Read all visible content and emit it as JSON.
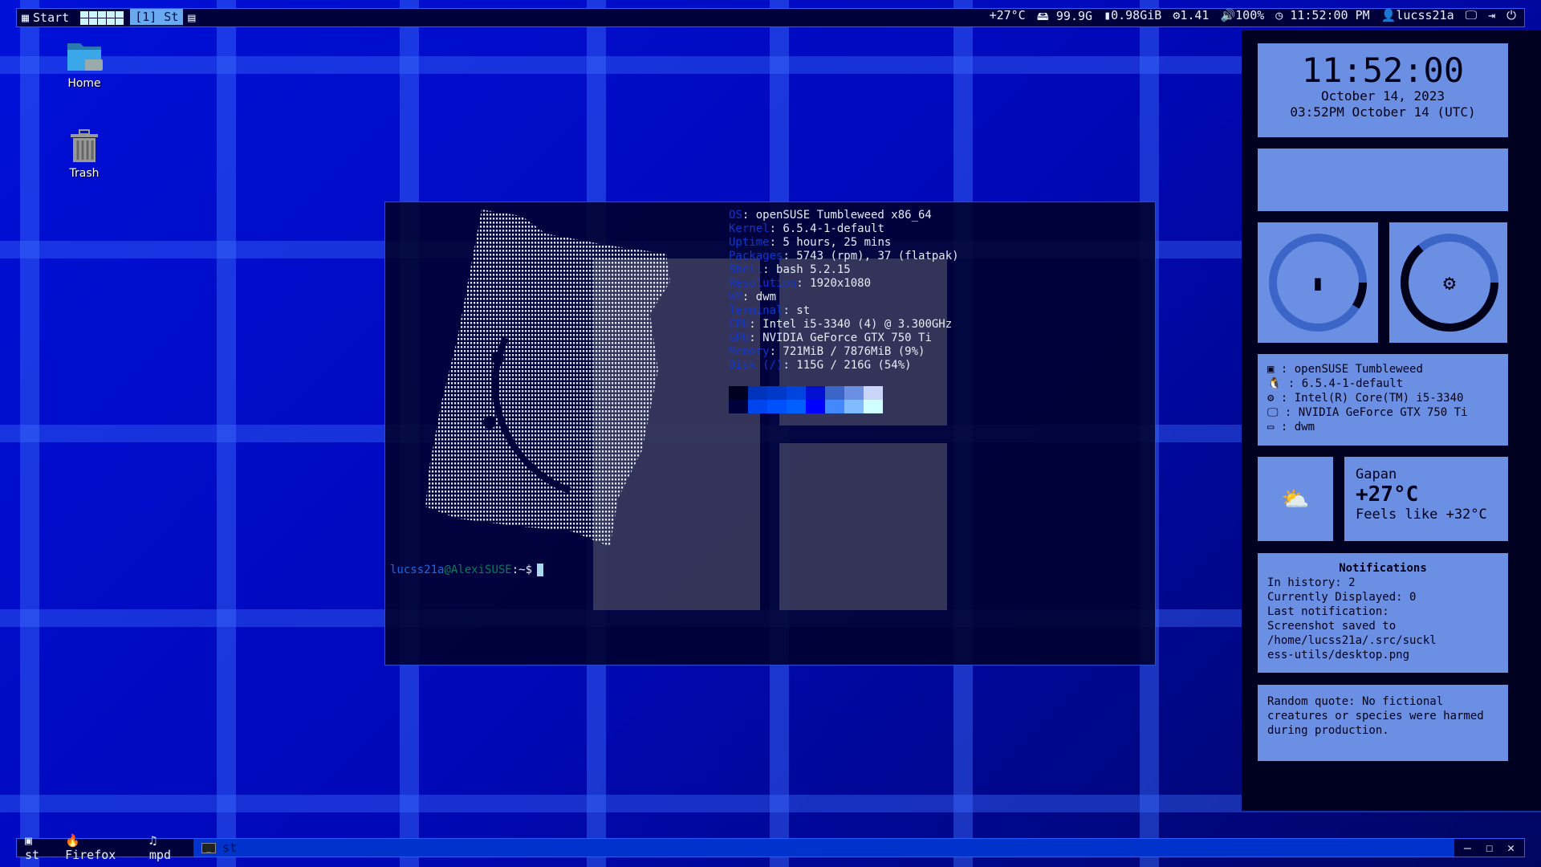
{
  "topbar": {
    "start": "Start",
    "tag": "[1] St",
    "temp": "+27°C",
    "disk": "99.9G",
    "mem": "0.98GiB",
    "cpu": "1.41",
    "volume": "100%",
    "clock": "11:52:00 PM",
    "user": "lucss21a"
  },
  "desktop": {
    "home": "Home",
    "trash": "Trash"
  },
  "terminal": {
    "info": [
      [
        "OS",
        "openSUSE Tumbleweed x86_64"
      ],
      [
        "Kernel",
        "6.5.4-1-default"
      ],
      [
        "Uptime",
        "5 hours, 25 mins"
      ],
      [
        "Packages",
        "5743 (rpm), 37 (flatpak)"
      ],
      [
        "Shell",
        "bash 5.2.15"
      ],
      [
        "Resolution",
        "1920x1080"
      ],
      [
        "WM",
        "dwm"
      ],
      [
        "Terminal",
        "st"
      ],
      [
        "CPU",
        "Intel i5-3340 (4) @ 3.300GHz"
      ],
      [
        "GPU",
        "NVIDIA GeForce GTX 750 Ti"
      ],
      [
        "Memory",
        "721MiB / 7876MiB (9%)"
      ],
      [
        "Disk (/)",
        "115G / 216G (54%)"
      ]
    ],
    "palette": [
      "#000020",
      "#0033bb",
      "#0039c8",
      "#0044e0",
      "#0010d0",
      "#3b66c8",
      "#6b8fe3",
      "#c8d4f8",
      "#00003a",
      "#0044ee",
      "#0050ff",
      "#0060ff",
      "#0000ff",
      "#4488ff",
      "#80bbff",
      "#d0ffff"
    ],
    "prompt_user": "lucss21a",
    "prompt_host": "@AlexiSUSE",
    "prompt_dir": ":~$"
  },
  "sidebar": {
    "time": "11:52:00",
    "date": "October 14, 2023",
    "utc": "03:52PM October 14 (UTC)",
    "mem_percent": 9,
    "cpu_percent": 64,
    "sysinfo": [
      {
        "icon": "distro-icon",
        "text": "openSUSE Tumbleweed"
      },
      {
        "icon": "linux-icon",
        "text": "6.5.4-1-default"
      },
      {
        "icon": "cpu-icon",
        "text": "Intel(R) Core(TM) i5-3340"
      },
      {
        "icon": "monitor-icon",
        "text": "NVIDIA GeForce GTX 750 Ti"
      },
      {
        "icon": "window-icon",
        "text": "dwm"
      }
    ],
    "weather": {
      "icon": "⛅",
      "city": "Gapan",
      "temp": "+27°C",
      "feels": "Feels like +32°C"
    },
    "notifications": {
      "title": "Notifications",
      "lines": [
        "In history: 2",
        "Currently Displayed: 0",
        "Last notification:",
        "Screenshot saved to",
        "/home/lucss21a/.src/suckl",
        "ess-utils/desktop.png"
      ]
    },
    "quote": "Random quote: No fictional creatures or species were harmed during production."
  },
  "taskbar": {
    "items": [
      "st",
      "Firefox",
      "mpd"
    ],
    "active": "st"
  },
  "colors": {
    "card": "#6b8fe3",
    "panel": "#000020",
    "accent": "#2a5cff"
  }
}
